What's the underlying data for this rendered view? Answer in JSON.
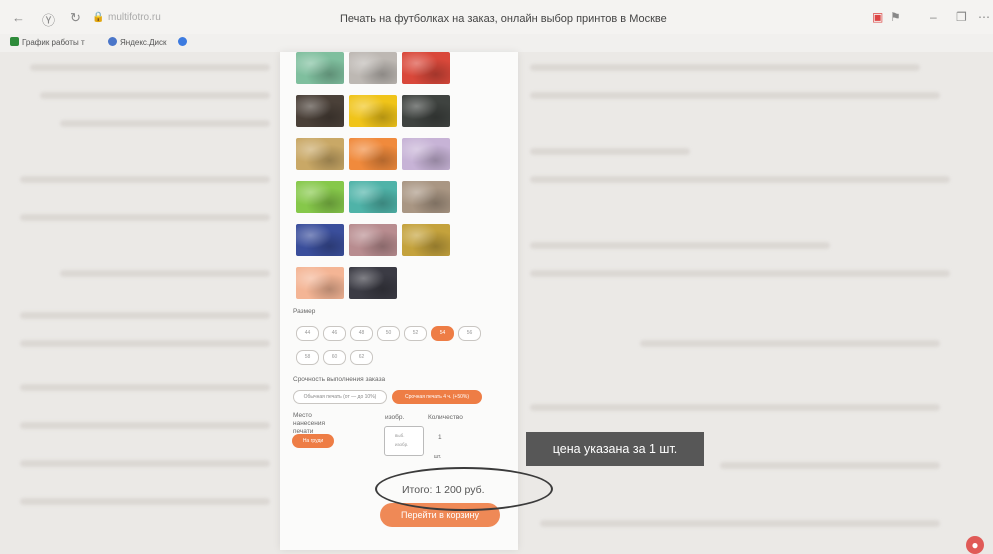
{
  "browser": {
    "url": "multifotro.ru",
    "title": "Печать на футболках на заказ, онлайн выбор принтов в Москве",
    "bookmarks": [
      "График работы т",
      "Яндекс.Диск",
      ""
    ]
  },
  "swatch_colors": [
    "#7fbf9e",
    "#bdb8b3",
    "#d9483a",
    "#4a4038",
    "#f0c419",
    "#3f4340",
    "#c9a866",
    "#f08a3c",
    "#c7b3d6",
    "#86c84a",
    "#4fb3a8",
    "#a99683",
    "#3a4e9b",
    "#b88c8f",
    "#c4a23c",
    "#f4b595",
    "#3b3b44"
  ],
  "configurator": {
    "size_label": "Размер",
    "sizes_row1": [
      "44",
      "46",
      "48",
      "50",
      "52",
      "54",
      "56"
    ],
    "sizes_row2": [
      "58",
      "60",
      "62"
    ],
    "active_size_index": 5,
    "deadline_label": "Срочность выполнения заказа",
    "deadline_options": [
      "Обычная печать (от — до 10%)",
      "Срочная печать 4 ч. (+50%)"
    ],
    "active_deadline_index": 1,
    "print_place_label": "Место нанесения печати",
    "print_place_button": "На груди",
    "image_label": "изобр.",
    "image_box_line1": "выб.",
    "image_box_line2": "изобр.",
    "quantity_label": "Количество",
    "quantity_value": "1",
    "unit": "шт.",
    "total": "Итого: 1 200 руб.",
    "cart_button": "Перейти в корзину"
  },
  "annotation": {
    "tooltip": "цена указана за 1 шт."
  },
  "fab_icon": "chat-icon",
  "accent": "#ee7d45"
}
